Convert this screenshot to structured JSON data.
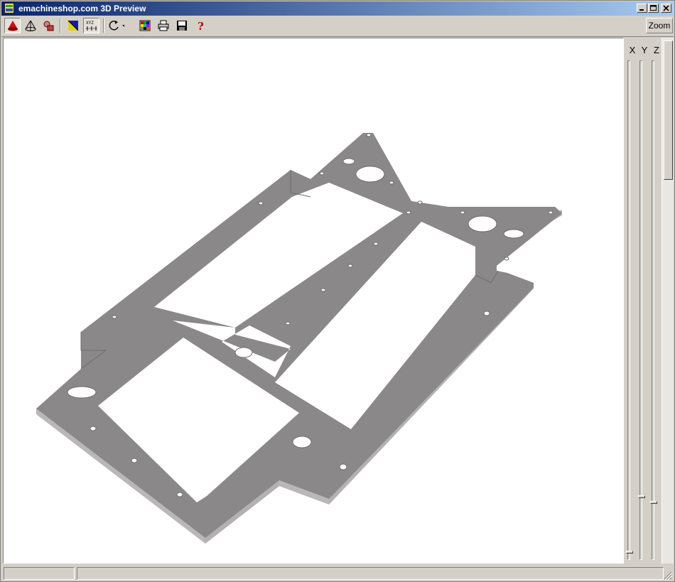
{
  "window": {
    "title": "emachineshop.com 3D Preview",
    "controls": {
      "minimize": "0",
      "maximize": "1",
      "close": "r"
    }
  },
  "toolbar": {
    "tools": [
      {
        "name": "solid-view",
        "icon": "red-cone-icon"
      },
      {
        "name": "wireframe-view",
        "icon": "wireframe-cone-icon"
      },
      {
        "name": "parts-view",
        "icon": "parts-icon"
      },
      {
        "name": "shading",
        "icon": "shading-square-icon"
      },
      {
        "name": "axes",
        "icon": "xyz-axes-icon",
        "pressed": true
      },
      {
        "name": "rotate",
        "icon": "rotate-arrows-icon"
      },
      {
        "name": "colors",
        "icon": "color-grid-icon"
      },
      {
        "name": "print",
        "icon": "printer-icon"
      },
      {
        "name": "save",
        "icon": "floppy-disk-icon"
      },
      {
        "name": "help",
        "icon": "help-question-icon"
      }
    ],
    "zoom_label": "Zoom"
  },
  "axes": {
    "x_label": "X",
    "y_label": "Y",
    "z_label": "Z"
  },
  "status": {
    "pane1": "",
    "pane2": ""
  },
  "colors": {
    "part_top": "#8a8888",
    "part_side": "#b9b7b7",
    "viewport_bg": "#ffffff"
  }
}
